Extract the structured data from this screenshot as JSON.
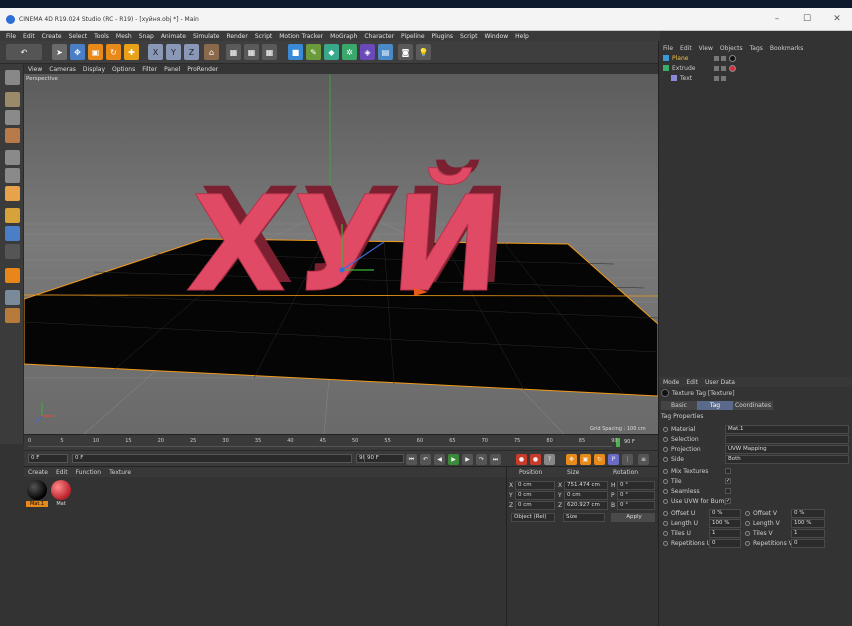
{
  "window": {
    "title": "CINEMA 4D R19.024 Studio (RC - R19) - [хуйня.obj *] - Main",
    "controls": [
      "–",
      "☐",
      "✕"
    ]
  },
  "menubar": [
    "File",
    "Edit",
    "Create",
    "Select",
    "Tools",
    "Mesh",
    "Snap",
    "Animate",
    "Simulate",
    "Render",
    "Script",
    "Motion Tracker",
    "MoGraph",
    "Character",
    "Pipeline",
    "Plugins",
    "Script",
    "Window",
    "Help"
  ],
  "viewport": {
    "menu": [
      "View",
      "Cameras",
      "Display",
      "Options",
      "Filter",
      "Panel",
      "ProRender"
    ],
    "label": "Perspective",
    "grid_spacing": "Grid Spacing : 100 cm",
    "text3d": "ХУЙ",
    "colors": {
      "text": "#e04a64",
      "floor": "#050505",
      "outline": "#f29b1a"
    }
  },
  "timeline": {
    "ticks": [
      "0",
      "5",
      "10",
      "15",
      "20",
      "25",
      "30",
      "35",
      "40",
      "45",
      "50",
      "55",
      "60",
      "65",
      "70",
      "75",
      "80",
      "85",
      "90"
    ],
    "current_frame": "90 F"
  },
  "transport": {
    "start": "0 F",
    "current": "0 F",
    "end": "90 F",
    "end2": "90 F"
  },
  "material_manager": {
    "menu": [
      "Create",
      "Edit",
      "Function",
      "Texture"
    ],
    "materials": [
      {
        "name": "Mat.1",
        "color": "#1a1a1a",
        "selected": true
      },
      {
        "name": "Mat",
        "color": "#d93040",
        "selected": false
      }
    ]
  },
  "coordinates": {
    "headers": [
      "Position",
      "Size",
      "Rotation"
    ],
    "rows": [
      {
        "axis": "X",
        "pos": "0 cm",
        "size_axis": "X",
        "size": "751.474 cm",
        "rot_axis": "H",
        "rot": "0 °"
      },
      {
        "axis": "Y",
        "pos": "0 cm",
        "size_axis": "Y",
        "size": "0 cm",
        "rot_axis": "P",
        "rot": "0 °"
      },
      {
        "axis": "Z",
        "pos": "0 cm",
        "size_axis": "Z",
        "size": "620.927 cm",
        "rot_axis": "B",
        "rot": "0 °"
      }
    ],
    "mode": "Object (Rel)",
    "size_mode": "Size",
    "apply": "Apply"
  },
  "object_manager": {
    "menu": [
      "File",
      "Edit",
      "View",
      "Objects",
      "Tags",
      "Bookmarks"
    ],
    "objects": [
      {
        "name": "Plane",
        "indent": 0
      },
      {
        "name": "Extrude",
        "indent": 0
      },
      {
        "name": "Text",
        "indent": 1
      }
    ]
  },
  "attribute_manager": {
    "menu": [
      "Mode",
      "Edit",
      "User Data"
    ],
    "tag_title": "Texture Tag [Texture]",
    "tabs": [
      "Basic",
      "Tag",
      "Coordinates"
    ],
    "section": "Tag Properties",
    "props": [
      {
        "label": "Material",
        "value": "Mat.1"
      },
      {
        "label": "Selection",
        "value": ""
      },
      {
        "label": "Projection",
        "value": "UVW Mapping"
      },
      {
        "label": "Side",
        "value": "Both"
      }
    ],
    "checks": [
      {
        "label": "Mix Textures",
        "checked": false
      },
      {
        "label": "Tile",
        "checked": true
      },
      {
        "label": "Seamless",
        "checked": false
      },
      {
        "label": "Use UVW for Bump",
        "checked": true
      }
    ],
    "offsets": [
      {
        "l1": "Offset U",
        "v1": "0 %",
        "l2": "Offset V",
        "v2": "0 %"
      },
      {
        "l1": "Length U",
        "v1": "100 %",
        "l2": "Length V",
        "v2": "100 %"
      },
      {
        "l1": "Tiles U",
        "v1": "1",
        "l2": "Tiles V",
        "v2": "1"
      },
      {
        "l1": "Repetitions U",
        "v1": "0",
        "l2": "Repetitions V",
        "v2": "0"
      }
    ]
  }
}
